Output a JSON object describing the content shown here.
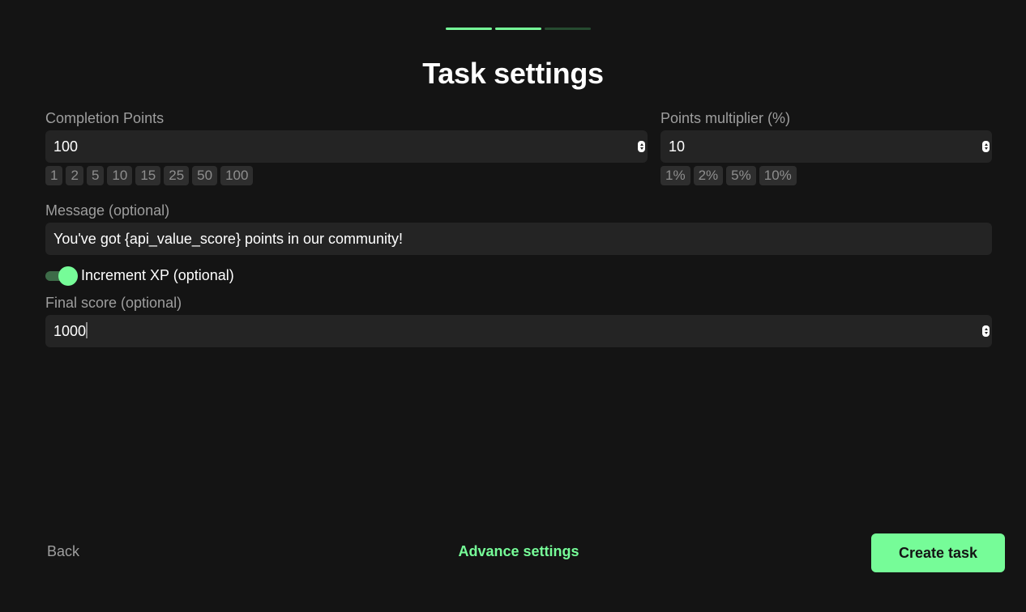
{
  "progress": {
    "total_steps": 3,
    "current_step": 2
  },
  "title": "Task settings",
  "completion_points": {
    "label": "Completion Points",
    "value": "100",
    "presets": [
      "1",
      "2",
      "5",
      "10",
      "15",
      "25",
      "50",
      "100"
    ]
  },
  "points_multiplier": {
    "label": "Points multiplier (%)",
    "value": "10",
    "presets": [
      "1%",
      "2%",
      "5%",
      "10%"
    ]
  },
  "message": {
    "label": "Message (optional)",
    "value": "You've got {api_value_score} points in our community!"
  },
  "increment_xp": {
    "label": "Increment XP (optional)",
    "enabled": true
  },
  "final_score": {
    "label": "Final score (optional)",
    "value": "1000"
  },
  "footer": {
    "back_label": "Back",
    "advance_label": "Advance settings",
    "create_label": "Create task"
  },
  "colors": {
    "background": "#141414",
    "accent": "#76fc98",
    "field_bg": "#242424",
    "muted_text": "#9e9e9e"
  }
}
